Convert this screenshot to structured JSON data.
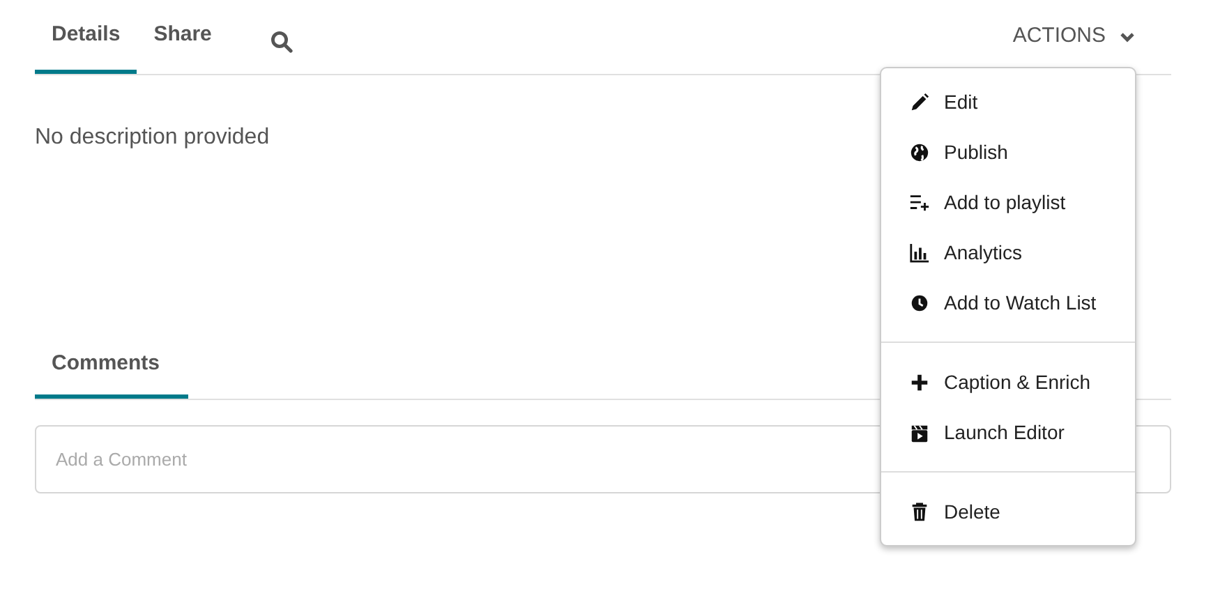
{
  "tabs": [
    {
      "label": "Details",
      "selected": true
    },
    {
      "label": "Share",
      "selected": false
    }
  ],
  "actions": {
    "label": "ACTIONS",
    "expanded": true
  },
  "description": "No description provided",
  "comments_tabs": [
    {
      "label": "Comments",
      "selected": true
    }
  ],
  "comment_field": {
    "placeholder": "Add a Comment"
  },
  "menu": {
    "groups": [
      {
        "items": [
          {
            "label": "Edit"
          },
          {
            "label": "Publish"
          },
          {
            "label": "Add to playlist"
          },
          {
            "label": "Analytics"
          },
          {
            "label": "Add to Watch List"
          }
        ]
      },
      {
        "items": [
          {
            "label": "Caption & Enrich"
          },
          {
            "label": "Launch Editor"
          }
        ]
      },
      {
        "items": [
          {
            "label": "Delete"
          }
        ]
      }
    ]
  }
}
